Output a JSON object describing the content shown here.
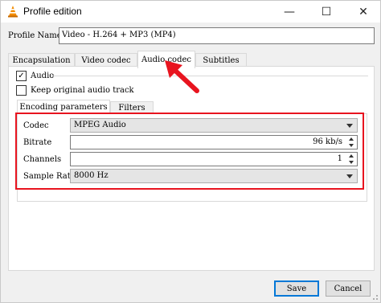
{
  "window": {
    "title": "Profile edition",
    "minimize_glyph": "—",
    "maximize_glyph": "☐",
    "close_glyph": "✕"
  },
  "profile": {
    "label": "Profile Name",
    "value": "Video - H.264 + MP3 (MP4)"
  },
  "tabs": [
    {
      "label": "Encapsulation",
      "active": false
    },
    {
      "label": "Video codec",
      "active": false
    },
    {
      "label": "Audio codec",
      "active": true
    },
    {
      "label": "Subtitles",
      "active": false
    }
  ],
  "audio": {
    "audio_label": "Audio",
    "audio_checked": true,
    "check_glyph": "✓",
    "keep_label": "Keep original audio track",
    "keep_checked": false
  },
  "subtabs": [
    {
      "label": "Encoding parameters",
      "active": true
    },
    {
      "label": "Filters",
      "active": false
    }
  ],
  "fields": {
    "codec_label": "Codec",
    "codec_value": "MPEG Audio",
    "bitrate_label": "Bitrate",
    "bitrate_value": "96 kb/s",
    "channels_label": "Channels",
    "channels_value": "1",
    "samplerate_label": "Sample Rate",
    "samplerate_value": "8000 Hz"
  },
  "buttons": {
    "save": "Save",
    "cancel": "Cancel"
  },
  "colors": {
    "highlight": "#e8141f",
    "focus": "#0078d7",
    "vlc_orange": "#f28c00"
  },
  "icons": {
    "app": "vlc-cone-icon",
    "arrow": "red-arrow-icon"
  }
}
